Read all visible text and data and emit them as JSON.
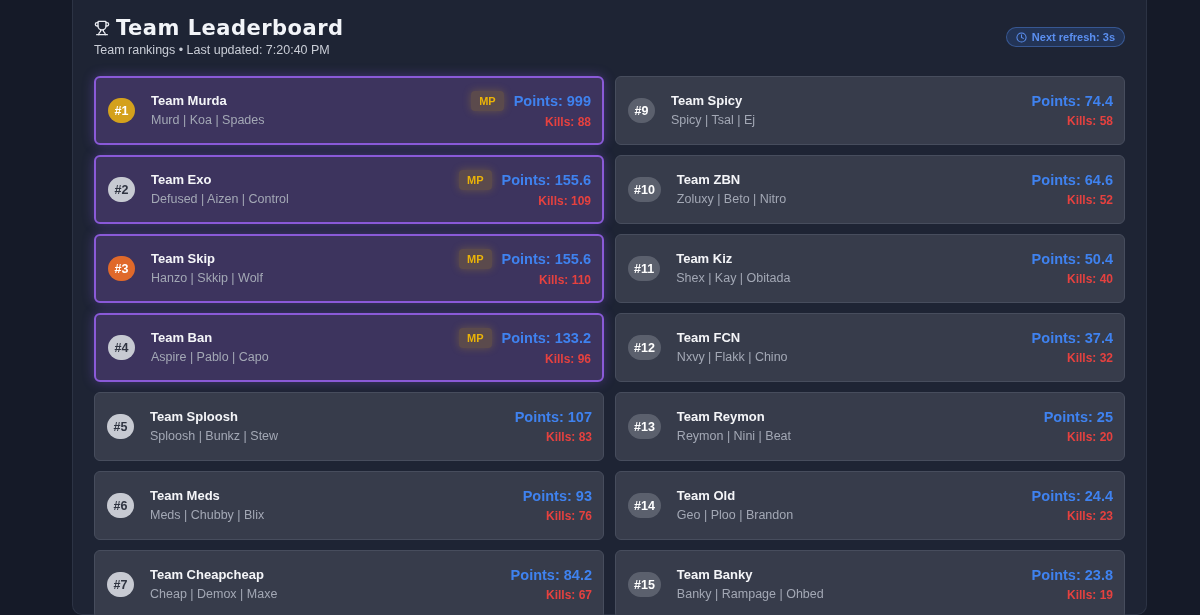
{
  "header": {
    "title": "Team Leaderboard",
    "subtitle": "Team rankings • Last updated: 7:20:40 PM",
    "refresh": "Next refresh: 3s"
  },
  "columns": [
    [
      {
        "rank": "#1",
        "color": "#d4a11c",
        "name": "Team Murda",
        "players": "Murd | Koa | Spades",
        "mp": true,
        "mp_label": "MP",
        "points": "Points: 999",
        "kills": "Kills: 88"
      },
      {
        "rank": "#2",
        "color": "#c7cad2",
        "name": "Team Exo",
        "players": "Defused | Aizen | Control",
        "mp": true,
        "mp_label": "MP",
        "points": "Points: 155.6",
        "kills": "Kills: 109"
      },
      {
        "rank": "#3",
        "color": "#e0692a",
        "name": "Team Skip",
        "players": "Hanzo | Skkip | Wolf",
        "mp": true,
        "mp_label": "MP",
        "points": "Points: 155.6",
        "kills": "Kills: 110"
      },
      {
        "rank": "#4",
        "color": "#c7cad2",
        "name": "Team Ban",
        "players": "Aspire | Pablo | Capo",
        "mp": true,
        "mp_label": "MP",
        "points": "Points: 133.2",
        "kills": "Kills: 96"
      },
      {
        "rank": "#5",
        "color": "#c7cad2",
        "name": "Team Sploosh",
        "players": "Sploosh | Bunkz | Stew",
        "mp": false,
        "points": "Points: 107",
        "kills": "Kills: 83"
      },
      {
        "rank": "#6",
        "color": "#c7cad2",
        "name": "Team Meds",
        "players": "Meds | Chubby | Blix",
        "mp": false,
        "points": "Points: 93",
        "kills": "Kills: 76"
      },
      {
        "rank": "#7",
        "color": "#c7cad2",
        "name": "Team Cheapcheap",
        "players": "Cheap | Demox | Maxe",
        "mp": false,
        "points": "Points: 84.2",
        "kills": "Kills: 67"
      }
    ],
    [
      {
        "rank": "#9",
        "color": "#5b606d",
        "name": "Team Spicy",
        "players": "Spicy | Tsal | Ej",
        "mp": false,
        "points": "Points: 74.4",
        "kills": "Kills: 58"
      },
      {
        "rank": "#10",
        "color": "#5b606d",
        "name": "Team ZBN",
        "players": "Zoluxy | Beto | Nitro",
        "mp": false,
        "points": "Points: 64.6",
        "kills": "Kills: 52"
      },
      {
        "rank": "#11",
        "color": "#5b606d",
        "name": "Team Kiz",
        "players": "Shex | Kay | Obitada",
        "mp": false,
        "points": "Points: 50.4",
        "kills": "Kills: 40"
      },
      {
        "rank": "#12",
        "color": "#5b606d",
        "name": "Team FCN",
        "players": "Nxvy | Flakk | Chino",
        "mp": false,
        "points": "Points: 37.4",
        "kills": "Kills: 32"
      },
      {
        "rank": "#13",
        "color": "#5b606d",
        "name": "Team Reymon",
        "players": "Reymon | Nini | Beat",
        "mp": false,
        "points": "Points: 25",
        "kills": "Kills: 20"
      },
      {
        "rank": "#14",
        "color": "#5b606d",
        "name": "Team Old",
        "players": "Geo | Ploo | Brandon",
        "mp": false,
        "points": "Points: 24.4",
        "kills": "Kills: 23"
      },
      {
        "rank": "#15",
        "color": "#5b606d",
        "name": "Team Banky",
        "players": "Banky | Rampage | Ohbed",
        "mp": false,
        "points": "Points: 23.8",
        "kills": "Kills: 19"
      }
    ]
  ]
}
